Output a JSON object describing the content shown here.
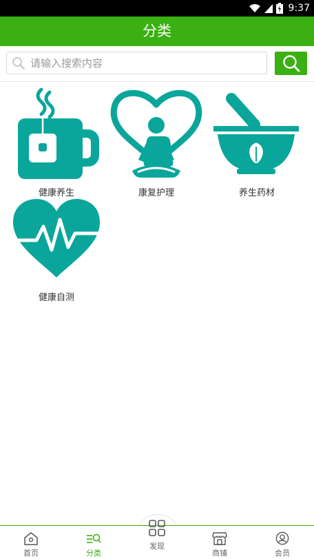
{
  "status_bar": {
    "time": "9:37",
    "icons": [
      "wifi-icon",
      "signal-icon",
      "battery-icon"
    ]
  },
  "header": {
    "title": "分类"
  },
  "search": {
    "placeholder": "请输入搜索内容",
    "icon": "search-icon"
  },
  "categories": [
    {
      "label": "健康养生",
      "icon": "tea-cup-icon"
    },
    {
      "label": "康复护理",
      "icon": "meditation-heart-icon"
    },
    {
      "label": "养生药材",
      "icon": "mortar-pestle-icon"
    },
    {
      "label": "健康自测",
      "icon": "heart-pulse-icon"
    }
  ],
  "tabbar": {
    "items": [
      {
        "label": "首页",
        "icon": "home-icon"
      },
      {
        "label": "分类",
        "icon": "category-icon",
        "active": true
      },
      {
        "label": "发现",
        "icon": "grid-icon"
      },
      {
        "label": "商铺",
        "icon": "shop-icon"
      },
      {
        "label": "会员",
        "icon": "user-icon"
      }
    ]
  },
  "colors": {
    "brand": "#3ab012",
    "icon_teal": "#0aa69b"
  }
}
